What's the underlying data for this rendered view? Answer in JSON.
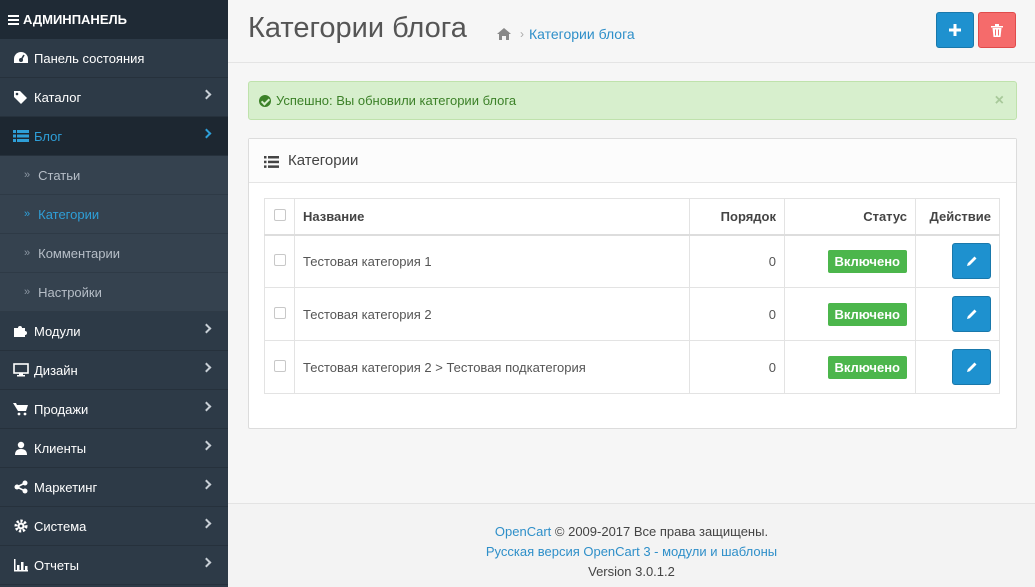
{
  "sidebar": {
    "header": "АДМИНПАНЕЛЬ",
    "items": [
      {
        "label": "Панель состояния",
        "icon": "dashboard-icon"
      },
      {
        "label": "Каталог",
        "icon": "tags-icon"
      },
      {
        "label": "Блог",
        "icon": "list-icon",
        "active": true
      },
      {
        "label": "Модули",
        "icon": "puzzle-icon"
      },
      {
        "label": "Дизайн",
        "icon": "desktop-icon"
      },
      {
        "label": "Продажи",
        "icon": "cart-icon"
      },
      {
        "label": "Клиенты",
        "icon": "user-icon"
      },
      {
        "label": "Маркетинг",
        "icon": "share-icon"
      },
      {
        "label": "Система",
        "icon": "gear-icon"
      },
      {
        "label": "Отчеты",
        "icon": "bar-chart-icon"
      }
    ],
    "blog_sub": [
      {
        "label": "Статьи"
      },
      {
        "label": "Категории",
        "active": true
      },
      {
        "label": "Комментарии"
      },
      {
        "label": "Настройки"
      }
    ]
  },
  "header": {
    "title": "Категории блога",
    "breadcrumb": "Категории блога"
  },
  "alert": {
    "text": "Успешно: Вы обновили категории блога",
    "close": "×"
  },
  "panel": {
    "title": "Категории",
    "columns": {
      "name": "Название",
      "order": "Порядок",
      "status": "Статус",
      "action": "Действие"
    },
    "rows": [
      {
        "name": "Тестовая категория 1",
        "order": "0",
        "status": "Включено"
      },
      {
        "name": "Тестовая категория 2",
        "order": "0",
        "status": "Включено"
      },
      {
        "name": "Тестовая категория 2 > Тестовая подкатегория",
        "order": "0",
        "status": "Включено"
      }
    ]
  },
  "footer": {
    "brand": "OpenCart",
    "copyright": " © 2009-2017 Все права защищены.",
    "link": "Русская версия OpenCart 3 - модули и шаблоны",
    "version": "Version 3.0.1.2"
  },
  "colors": {
    "sidebar_bg": "#2d3a47",
    "accent": "#1e91cf",
    "danger": "#f56b6b",
    "success_badge": "#4cb64c",
    "alert_bg": "#d7efcd"
  }
}
